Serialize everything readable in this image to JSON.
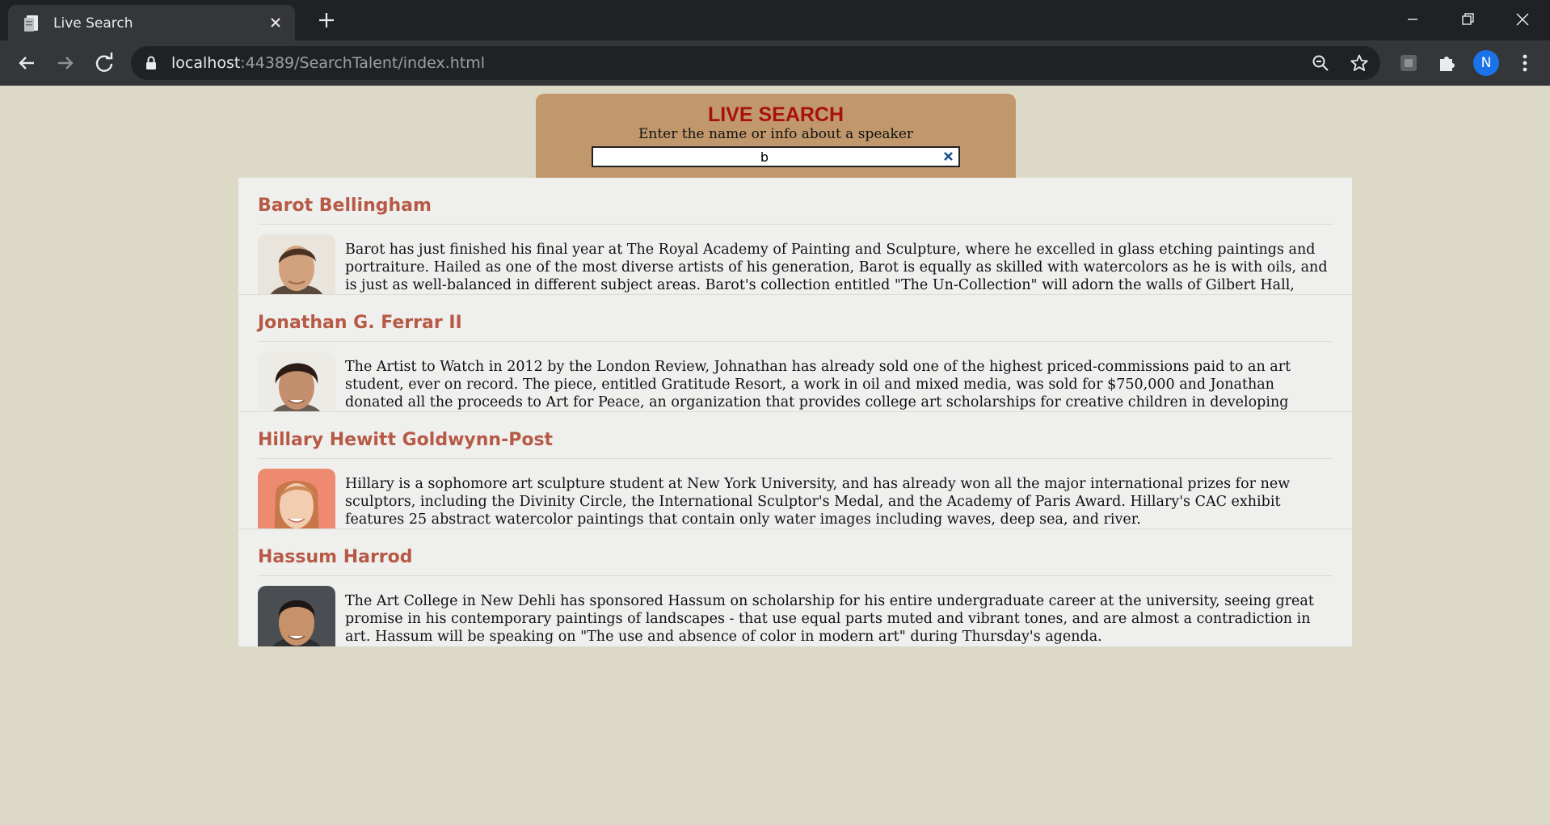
{
  "browser": {
    "tab_title": "Live Search",
    "url_host": "localhost",
    "url_path": ":44389/SearchTalent/index.html",
    "profile_initial": "N"
  },
  "search": {
    "title": "LIVE SEARCH",
    "subtitle": "Enter the name or info about a speaker",
    "query": "b"
  },
  "results": [
    {
      "name": "Barot Bellingham",
      "bio": "Barot has just finished his final year at The Royal Academy of Painting and Sculpture, where he excelled in glass etching paintings and portraiture. Hailed as one of the most diverse artists of his generation, Barot is equally as skilled with watercolors as he is with oils, and is just as well-balanced in different subject areas. Barot's collection entitled \"The Un-Collection\" will adorn the walls of Gilbert Hall, depicting his range of",
      "photo_bg": "#e9e4dc"
    },
    {
      "name": "Jonathan G. Ferrar II",
      "bio": "The Artist to Watch in 2012 by the London Review, Johnathan has already sold one of the highest priced-commissions paid to an art student, ever on record. The piece, entitled Gratitude Resort, a work in oil and mixed media, was sold for $750,000 and Jonathan donated all the proceeds to Art for Peace, an organization that provides college art scholarships for creative children in developing nations",
      "photo_bg": "#ecebe6"
    },
    {
      "name": "Hillary Hewitt Goldwynn-Post",
      "bio": "Hillary is a sophomore art sculpture student at New York University, and has already won all the major international prizes for new sculptors, including the Divinity Circle, the International Sculptor's Medal, and the Academy of Paris Award. Hillary's CAC exhibit features 25 abstract watercolor paintings that contain only water images including waves, deep sea, and river.",
      "photo_bg": "#ee8a70"
    },
    {
      "name": "Hassum Harrod",
      "bio": "The Art College in New Dehli has sponsored Hassum on scholarship for his entire undergraduate career at the university, seeing great promise in his contemporary paintings of landscapes - that use equal parts muted and vibrant tones, and are almost a contradiction in art. Hassum will be speaking on \"The use and absence of color in modern art\" during Thursday's agenda.",
      "photo_bg": "#4a4d52"
    }
  ]
}
